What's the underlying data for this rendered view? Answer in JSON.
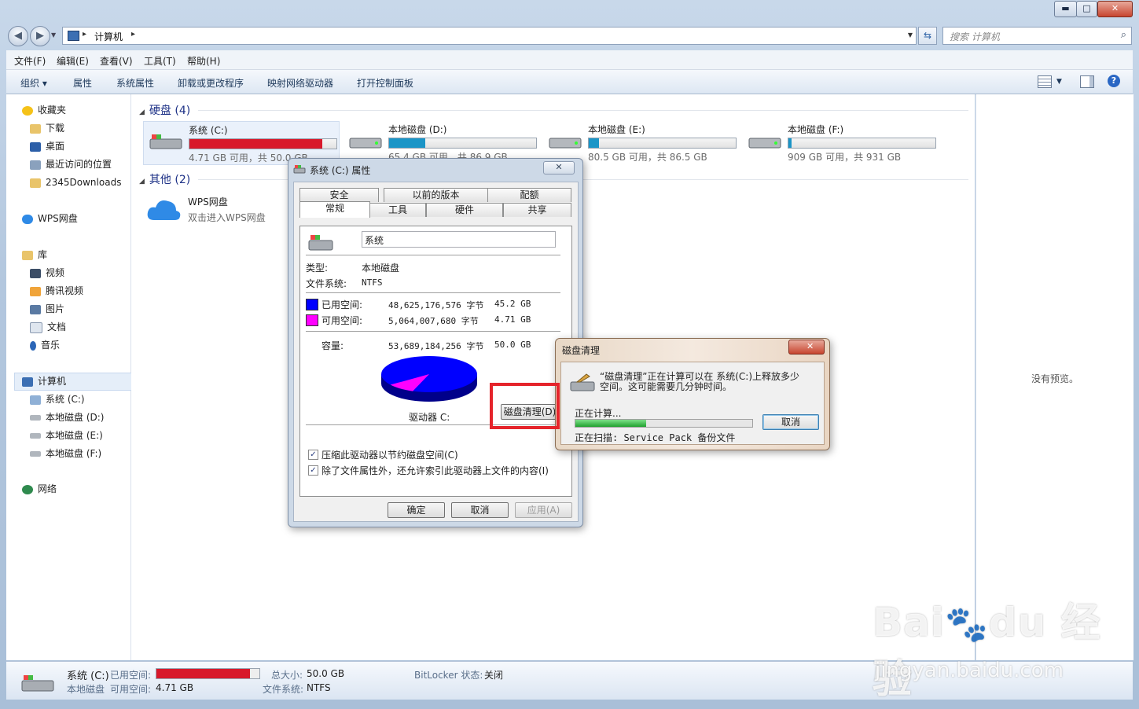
{
  "window": {
    "controls": {
      "minimize": "▬",
      "maximize": "□",
      "close": "✕"
    }
  },
  "address": {
    "path": "计算机",
    "search_placeholder": "搜索 计算机"
  },
  "menu": [
    "文件(F)",
    "编辑(E)",
    "查看(V)",
    "工具(T)",
    "帮助(H)"
  ],
  "toolbar": {
    "organize": "组织 ▾",
    "items": [
      "属性",
      "系统属性",
      "卸载或更改程序",
      "映射网络驱动器",
      "打开控制面板"
    ]
  },
  "nav": {
    "favorites": {
      "label": "收藏夹",
      "items": [
        "下载",
        "桌面",
        "最近访问的位置",
        "2345Downloads"
      ]
    },
    "wps": "WPS网盘",
    "library": {
      "label": "库",
      "items": [
        "视频",
        "腾讯视频",
        "图片",
        "文档",
        "音乐"
      ]
    },
    "computer": {
      "label": "计算机",
      "items": [
        "系统 (C:)",
        "本地磁盘 (D:)",
        "本地磁盘 (E:)",
        "本地磁盘 (F:)"
      ]
    },
    "network": "网络"
  },
  "groups": {
    "hdd": "硬盘 (4)",
    "other": "其他 (2)"
  },
  "drives": [
    {
      "name": "系统 (C:)",
      "free": "4.71 GB 可用，共 50.0 GB",
      "used_fraction": 0.906,
      "color": "#d8182a"
    },
    {
      "name": "本地磁盘 (D:)",
      "free": "65.4 GB 可用，共 86.9 GB",
      "used_fraction": 0.247,
      "color": "#1b95c7"
    },
    {
      "name": "本地磁盘 (E:)",
      "free": "80.5 GB 可用，共 86.5 GB",
      "used_fraction": 0.069,
      "color": "#1b95c7"
    },
    {
      "name": "本地磁盘 (F:)",
      "free": "909 GB 可用，共 931 GB",
      "used_fraction": 0.024,
      "color": "#1b95c7"
    }
  ],
  "other": {
    "name": "WPS网盘",
    "desc": "双击进入WPS网盘"
  },
  "preview": "没有预览。",
  "details": {
    "name": "系统 (C:)",
    "type": "本地磁盘",
    "used_label": "已用空间:",
    "free_label": "可用空间:",
    "free_value": "4.71 GB",
    "total_label": "总大小:",
    "total_value": "50.0 GB",
    "fs_label": "文件系统:",
    "fs_value": "NTFS",
    "bitlocker_label": "BitLocker 状态:",
    "bitlocker_value": "关闭",
    "used_fraction": 0.906
  },
  "props": {
    "title": "系统 (C:) 属性",
    "tabs_top": [
      "安全",
      "以前的版本",
      "配额"
    ],
    "tabs_bottom": [
      "常规",
      "工具",
      "硬件",
      "共享"
    ],
    "volume_name": "系统",
    "type_label": "类型:",
    "type_value": "本地磁盘",
    "fs_label": "文件系统:",
    "fs_value": "NTFS",
    "used_label": "已用空间:",
    "used_bytes": "48,625,176,576 字节",
    "used_gb": "45.2 GB",
    "free_label": "可用空间:",
    "free_bytes": "5,064,007,680 字节",
    "free_gb": "4.71 GB",
    "cap_label": "容量:",
    "cap_bytes": "53,689,184,256 字节",
    "cap_gb": "50.0 GB",
    "drive_label": "驱动器 C:",
    "cleanup_button": "磁盘清理(D)",
    "compress_check": "压缩此驱动器以节约磁盘空间(C)",
    "index_check": "除了文件属性外，还允许索引此驱动器上文件的内容(I)",
    "ok": "确定",
    "cancel": "取消",
    "apply": "应用(A)",
    "used_color": "#0000ff",
    "free_color": "#ff00ff"
  },
  "cleanup": {
    "title": "磁盘清理",
    "message_line1": "“磁盘清理”正在计算可以在 系统(C:)上释放多少",
    "message_line2": "空间。这可能需要几分钟时间。",
    "calculating": "正在计算...",
    "cancel": "取消",
    "scanning": "正在扫描:  Service Pack 备份文件",
    "progress": 0.4
  }
}
